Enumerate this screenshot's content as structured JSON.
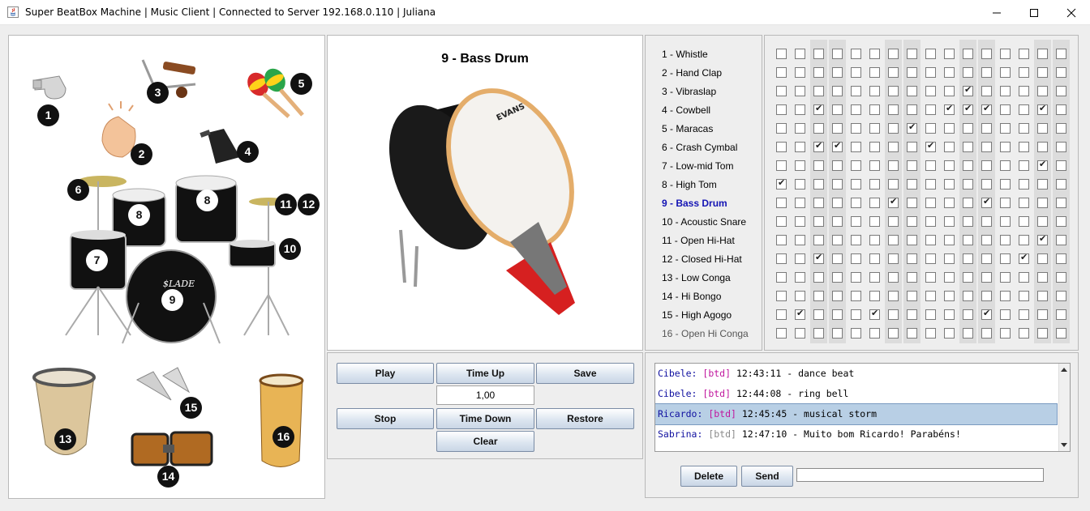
{
  "window": {
    "title": "Super BeatBox Machine | Music Client | Connected to Server 192.168.0.110 | Juliana"
  },
  "instruments_image": {
    "badges": [
      "1",
      "2",
      "3",
      "4",
      "5",
      "6",
      "7",
      "8",
      "8",
      "9",
      "10",
      "11",
      "12",
      "13",
      "14",
      "15",
      "16"
    ]
  },
  "preview": {
    "title": "9 - Bass Drum",
    "drum_logo": "EVANS"
  },
  "instruments": [
    "1 - Whistle",
    "2 - Hand Clap",
    "3 - Vibraslap",
    "4 - Cowbell",
    "5 - Maracas",
    "6 - Crash Cymbal",
    "7 - Low-mid Tom",
    "8 - High Tom",
    "9 - Bass Drum",
    "10 - Acoustic Snare",
    "11 - Open Hi-Hat",
    "12 - Closed Hi-Hat",
    "13 - Low Conga",
    "14 - Hi Bongo",
    "15 - High Agogo",
    "16 - Open Hi Conga"
  ],
  "selected_instrument_index": 8,
  "grid": {
    "columns": 16,
    "shaded_columns": [
      2,
      3,
      6,
      7,
      10,
      11,
      14,
      15
    ],
    "checked": [
      [],
      [],
      [
        10
      ],
      [
        2,
        9,
        10,
        11,
        14
      ],
      [
        7
      ],
      [
        2,
        3,
        8
      ],
      [
        14
      ],
      [
        0
      ],
      [
        6,
        11
      ],
      [],
      [
        14
      ],
      [
        2,
        13
      ],
      [],
      [],
      [
        1,
        5,
        11
      ],
      []
    ]
  },
  "controls": {
    "play": "Play",
    "time_up": "Time Up",
    "save": "Save",
    "tempo": "1,00",
    "stop": "Stop",
    "time_down": "Time Down",
    "restore": "Restore",
    "clear": "Clear"
  },
  "chat": {
    "messages": [
      {
        "user": "Cibele:",
        "tag": "[btd]",
        "tag_color": "#c0179e",
        "time": "12:43:11",
        "text": "- dance beat",
        "selected": false
      },
      {
        "user": "Cibele:",
        "tag": "[btd]",
        "tag_color": "#c0179e",
        "time": "12:44:08",
        "text": "- ring bell",
        "selected": false
      },
      {
        "user": "Ricardo:",
        "tag": "[btd]",
        "tag_color": "#c0179e",
        "time": "12:45:45",
        "text": "- musical storm",
        "selected": true
      },
      {
        "user": "Sabrina:",
        "tag": "[btd]",
        "tag_color": "#8a8a8a",
        "time": "12:47:10",
        "text": "- Muito bom Ricardo! Parabéns!",
        "selected": false
      }
    ],
    "delete": "Delete",
    "send": "Send",
    "input_value": ""
  },
  "colors": {
    "selected_instrument": "#1414b4",
    "user_name": "#1010a0",
    "selection_bg": "#b8cfe5"
  }
}
